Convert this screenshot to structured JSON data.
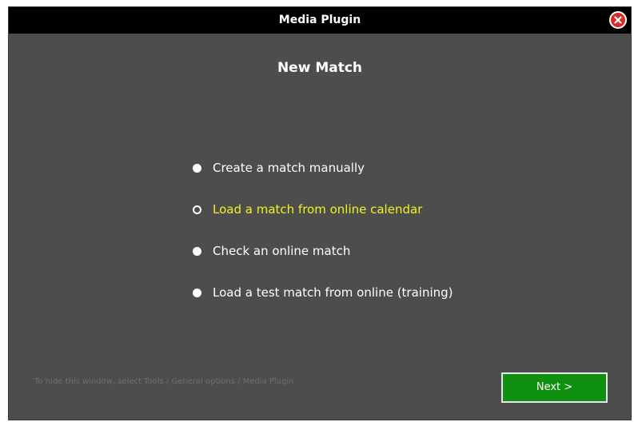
{
  "window": {
    "title": "Media Plugin",
    "close_icon": "close-icon"
  },
  "main": {
    "heading": "New Match",
    "options": [
      {
        "label": "Create a match manually",
        "selected": false
      },
      {
        "label": "Load a match from online calendar",
        "selected": true
      },
      {
        "label": "Check an online match",
        "selected": false
      },
      {
        "label": "Load a test match from online (training)",
        "selected": false
      }
    ]
  },
  "footer": {
    "hint": "To hide this window, select Tools / General options / Media Plugin",
    "next_label": "Next >"
  },
  "colors": {
    "window_bg": "#4d4d4d",
    "titlebar_bg": "#000000",
    "selected_text": "#f2f21e",
    "next_button_bg": "#109010",
    "close_button_bg": "#d62b2b"
  }
}
